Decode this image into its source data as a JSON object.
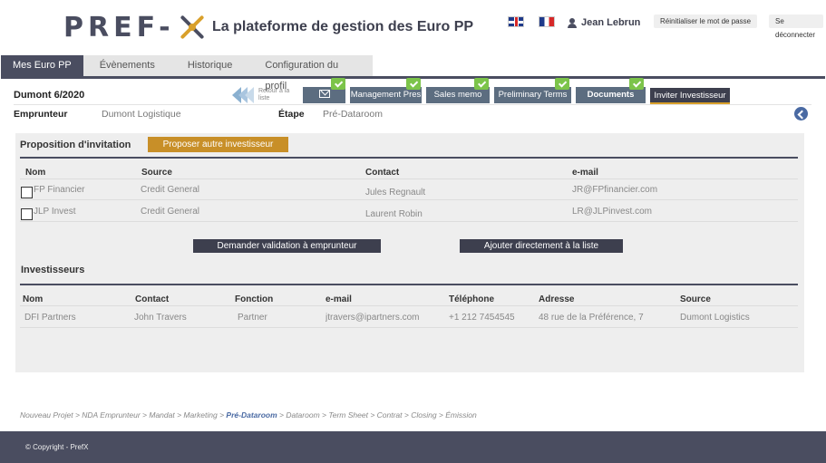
{
  "header": {
    "logo_text": "PREF-",
    "tagline": "La plateforme de gestion des Euro PP",
    "user_name": "Jean Lebrun",
    "reset_password": "Réinitialiser le mot de passe",
    "logout": "Se déconnecter"
  },
  "nav": {
    "tabs": [
      "Mes Euro PP",
      "Évènements",
      "Historique",
      "Configuration du profil"
    ]
  },
  "deal": {
    "title": "Dumont 6/2020",
    "back_to_list": "Retour à la liste",
    "steps": [
      "Management Pres",
      "Sales memo",
      "Preliminary Terms",
      "Documents"
    ],
    "invite": "Inviter Investisseur",
    "borrower_label": "Emprunteur",
    "borrower_value": "Dumont Logistique",
    "stage_label": "Étape",
    "stage_value": "Pré-Dataroom"
  },
  "invitation": {
    "title": "Proposition d'invitation",
    "propose_button": "Proposer autre investisseur",
    "columns": [
      "Nom",
      "Source",
      "Contact",
      "e-mail"
    ],
    "rows": [
      {
        "name": "FP Financier",
        "source": "Credit General",
        "contact": "Jules Regnault",
        "email": "JR@FPfinancier.com"
      },
      {
        "name": "JLP Invest",
        "source": "Credit General",
        "contact": "Laurent Robin",
        "email": "LR@JLPinvest.com"
      }
    ],
    "request_validation": "Demander validation à emprunteur",
    "add_directly": "Ajouter directement à la liste"
  },
  "investors": {
    "title": "Investisseurs",
    "columns": [
      "Nom",
      "Contact",
      "Fonction",
      "e-mail",
      "Téléphone",
      "Adresse",
      "Source"
    ],
    "rows": [
      {
        "name": "DFI Partners",
        "contact": "John Travers",
        "function": "Partner",
        "email": "jtravers@ipartners.com",
        "phone": "+1 212 7454545",
        "address": "48 rue de la Préférence, 7",
        "source": "Dumont Logistics"
      }
    ]
  },
  "breadcrumb": {
    "before": "Nouveau Projet > NDA Emprunteur > Mandat > Marketing > ",
    "current": "Pré-Dataroom",
    "after": " > Dataroom > Term Sheet > Contrat > Closing > Émission"
  },
  "footer": {
    "copyright": "© Copyright - PrefX"
  },
  "colors": {
    "primary": "#4a4d60",
    "accent": "#c88f28",
    "step_button": "#5c6d80",
    "check": "#7cc44a"
  }
}
